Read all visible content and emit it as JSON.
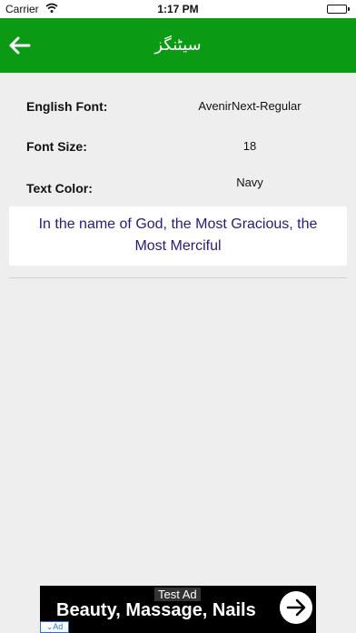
{
  "status_bar": {
    "carrier": "Carrier",
    "time": "1:17 PM"
  },
  "navbar": {
    "title": "سیٹنگز",
    "color": "#0a9a13"
  },
  "settings": [
    {
      "label": "English Font:",
      "value": "AvenirNext-Regular"
    },
    {
      "label": "Font Size:",
      "value": "18"
    },
    {
      "label": "Text Color:",
      "value": "Navy"
    }
  ],
  "preview": {
    "text": "In the name of God, the Most Gracious, the Most Merciful"
  },
  "ad": {
    "tag": "Test Ad",
    "headline": "Beauty, Massage, Nails",
    "badge": "Ad"
  }
}
